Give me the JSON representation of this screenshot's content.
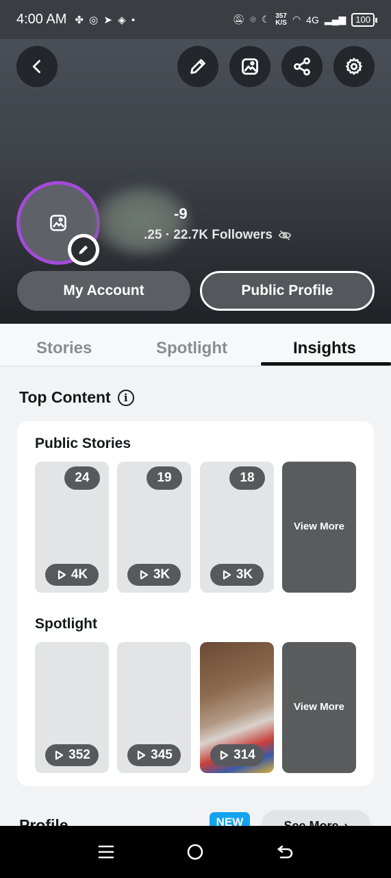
{
  "status_bar": {
    "time": "4:00 AM",
    "speed_value": "357",
    "speed_unit": "K/S",
    "network": "4G",
    "battery": "100"
  },
  "header": {
    "profile_name_partial": "-9",
    "stats_partial": ".25 · 22.7K Followers",
    "my_account_label": "My Account",
    "public_profile_label": "Public Profile"
  },
  "tabs": [
    {
      "label": "Stories",
      "active": false
    },
    {
      "label": "Spotlight",
      "active": false
    },
    {
      "label": "Insights",
      "active": true
    }
  ],
  "top_content": {
    "title": "Top Content",
    "public_stories": {
      "label": "Public Stories",
      "items": [
        {
          "count": "24",
          "views": "4K"
        },
        {
          "count": "19",
          "views": "3K"
        },
        {
          "count": "18",
          "views": "3K"
        }
      ],
      "view_more": "View More"
    },
    "spotlight": {
      "label": "Spotlight",
      "items": [
        {
          "views": "352"
        },
        {
          "views": "345"
        },
        {
          "views": "314"
        }
      ],
      "view_more": "View More"
    }
  },
  "profile_section": {
    "title_partial": "Profile",
    "new_badge": "NEW",
    "see_more": "See More"
  },
  "icons": {
    "back": "chevron-left-icon",
    "edit": "pencil-icon",
    "bitmoji": "image-icon",
    "share": "share-icon",
    "settings": "gear-icon",
    "hidden": "eye-off-icon",
    "info": "info-icon",
    "play": "play-icon"
  },
  "colors": {
    "avatar_ring": "#a44ad9",
    "new_badge": "#14a3f0"
  }
}
